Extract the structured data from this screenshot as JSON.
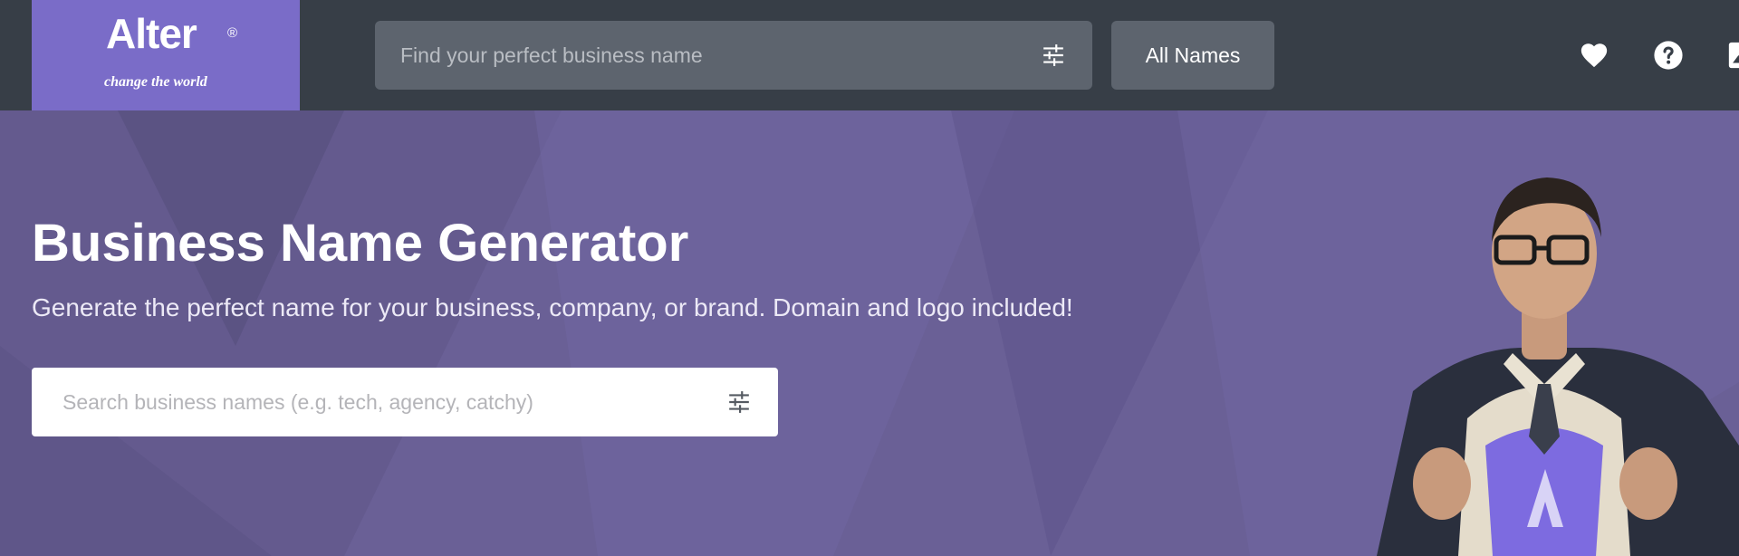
{
  "header": {
    "logo": {
      "name": "Alter",
      "registered": "®",
      "tagline": "change the world"
    },
    "search": {
      "placeholder": "Find your perfect business name",
      "icon": "filter-sliders-icon"
    },
    "all_names_label": "All Names",
    "icons": [
      "heart-icon",
      "help-icon",
      "image-icon"
    ]
  },
  "hero": {
    "title": "Business Name Generator",
    "subtitle": "Generate the perfect name for your business, company, or brand. Domain and logo included!",
    "search": {
      "placeholder": "Search business names (e.g. tech, agency, catchy)",
      "icon": "filter-sliders-icon"
    }
  },
  "colors": {
    "topbar_bg": "#373e47",
    "logo_bg": "#7a6cc8",
    "hero_bg": "#6a6096",
    "search_field_bg": "#5d646e"
  }
}
